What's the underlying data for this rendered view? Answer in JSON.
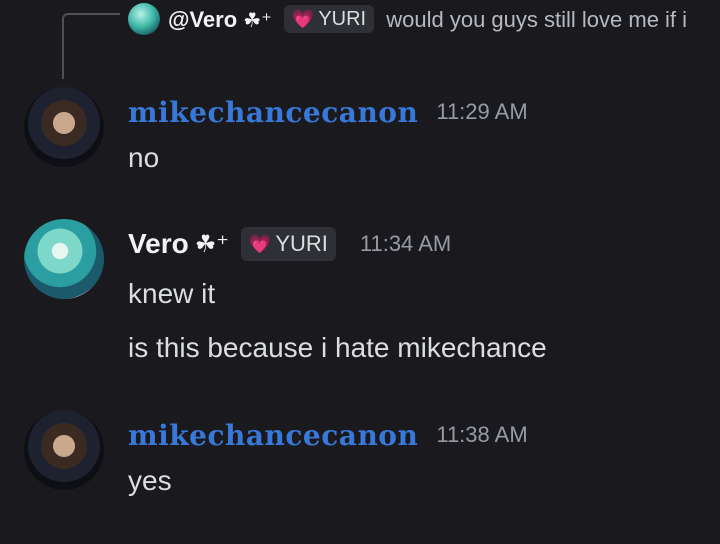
{
  "reply": {
    "author": "@Vero",
    "author_glyphs": "☘⁺",
    "role_heart": "💗",
    "role_name": "YURI",
    "text": "would you guys still love me if i"
  },
  "messages": [
    {
      "author": "mikechancecanon",
      "time": "11:29 AM",
      "lines": [
        "no"
      ]
    },
    {
      "author": "Vero",
      "author_glyphs": "☘⁺",
      "role_heart": "💗",
      "role_name": "YURI",
      "time": "11:34 AM",
      "lines": [
        "knew it",
        "is this because i hate mikechance"
      ]
    },
    {
      "author": "mikechancecanon",
      "time": "11:38 AM",
      "lines": [
        "yes"
      ]
    }
  ],
  "colors": {
    "background": "#1a1a1e",
    "mike_name": "#3878d8",
    "role_heart": "#f58ac6"
  }
}
